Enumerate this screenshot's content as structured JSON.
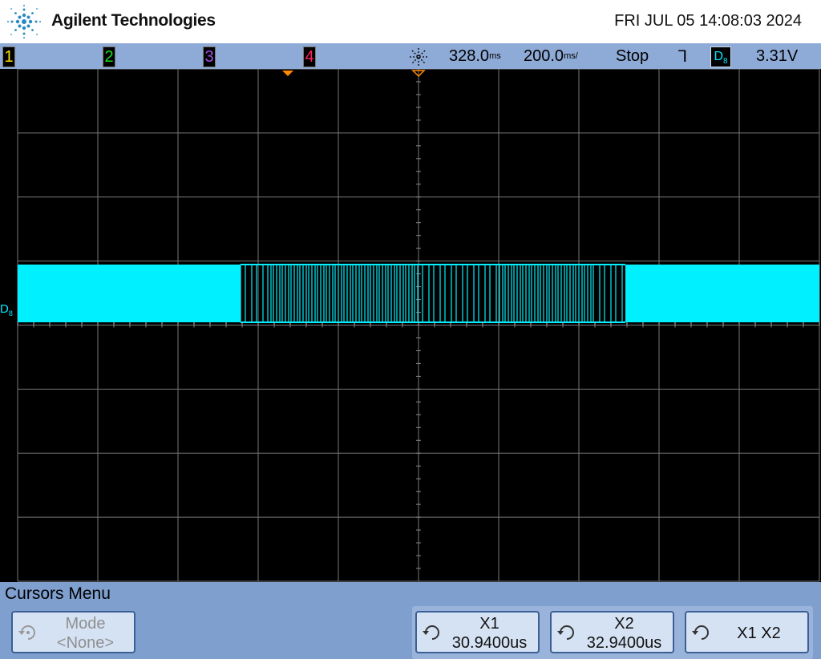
{
  "header": {
    "brand": "Agilent Technologies",
    "datetime": "FRI JUL 05 14:08:03 2024"
  },
  "status_bar": {
    "channels": [
      "1",
      "2",
      "3",
      "4"
    ],
    "trigger_position": "328.0",
    "trigger_position_unit": "ms",
    "timebase": "200.0",
    "timebase_unit": "ms/",
    "run_state": "Stop",
    "trigger_source": "D",
    "trigger_source_sub": "8",
    "trigger_level": "3.31V"
  },
  "waveform": {
    "channel_label": "D",
    "channel_sub": "8",
    "color": "#00f0ff"
  },
  "menu": {
    "title": "Cursors Menu",
    "softkeys": {
      "mode": {
        "label": "Mode",
        "value": "<None>"
      },
      "x1": {
        "label": "X1",
        "value": "30.9400us"
      },
      "x2": {
        "label": "X2",
        "value": "32.9400us"
      },
      "x1x2": {
        "label": "X1 X2"
      }
    }
  },
  "colors": {
    "status_bar": "#8eaad6",
    "menu_bar": "#7f9fcf",
    "trace": "#00f0ff",
    "grid": "#7a7a7a"
  }
}
